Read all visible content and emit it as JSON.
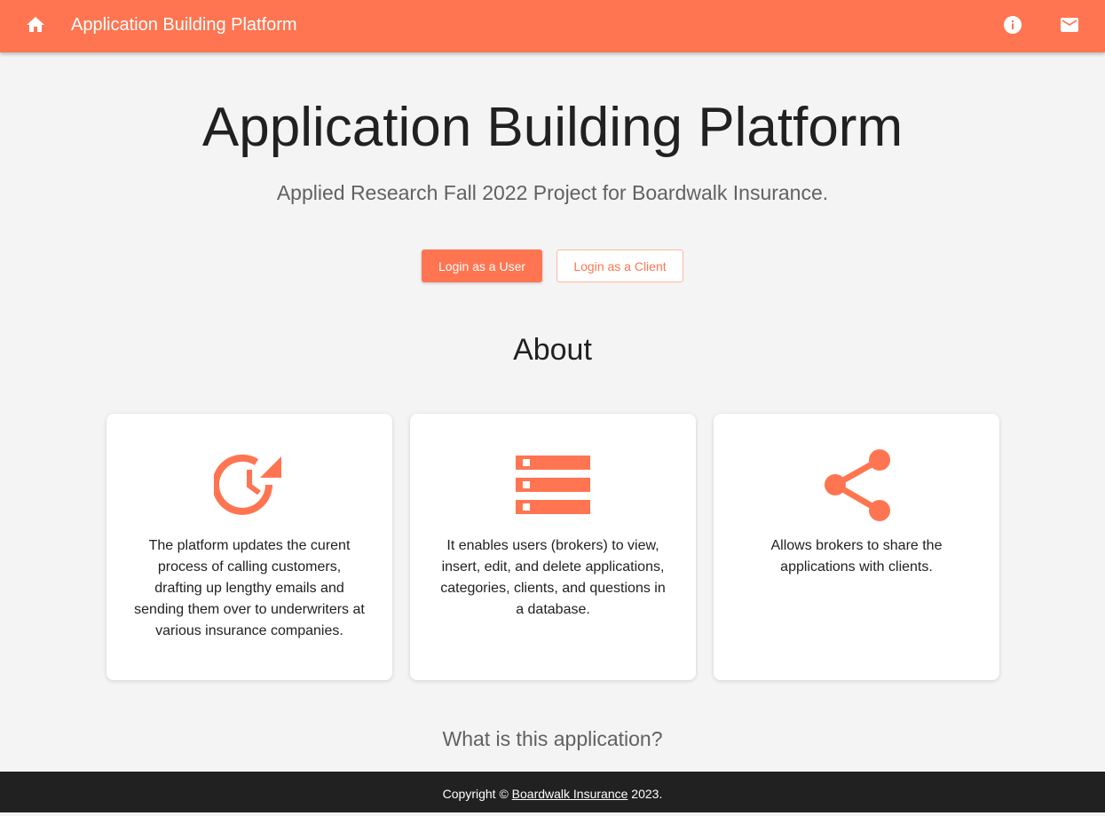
{
  "header": {
    "title": "Application Building Platform",
    "home_icon": "home-icon",
    "info_icon": "info-icon",
    "mail_icon": "mail-icon"
  },
  "hero": {
    "title": "Application Building Platform",
    "subtitle": "Applied Research Fall 2022 Project for Boardwalk Insurance."
  },
  "actions": {
    "login_user": "Login as a User",
    "login_client": "Login as a Client"
  },
  "about": {
    "heading": "About",
    "cards": [
      {
        "icon": "update-clock-icon",
        "text": "The platform updates the curent process of calling customers, drafting up lengthy emails and sending them over to underwriters at various insurance companies."
      },
      {
        "icon": "storage-list-icon",
        "text": "It enables users (brokers) to view, insert, edit, and delete applications, categories, clients, and questions in a database."
      },
      {
        "icon": "share-icon",
        "text": "Allows brokers to share the applications with clients."
      }
    ]
  },
  "section2": {
    "heading": "What is this application?"
  },
  "footer": {
    "prefix": "Copyright ©",
    "link": "Boardwalk Insurance",
    "suffix": "2023."
  },
  "colors": {
    "accent": "#ff7551",
    "footer_bg": "#212121",
    "page_bg": "#f4f4f4"
  }
}
